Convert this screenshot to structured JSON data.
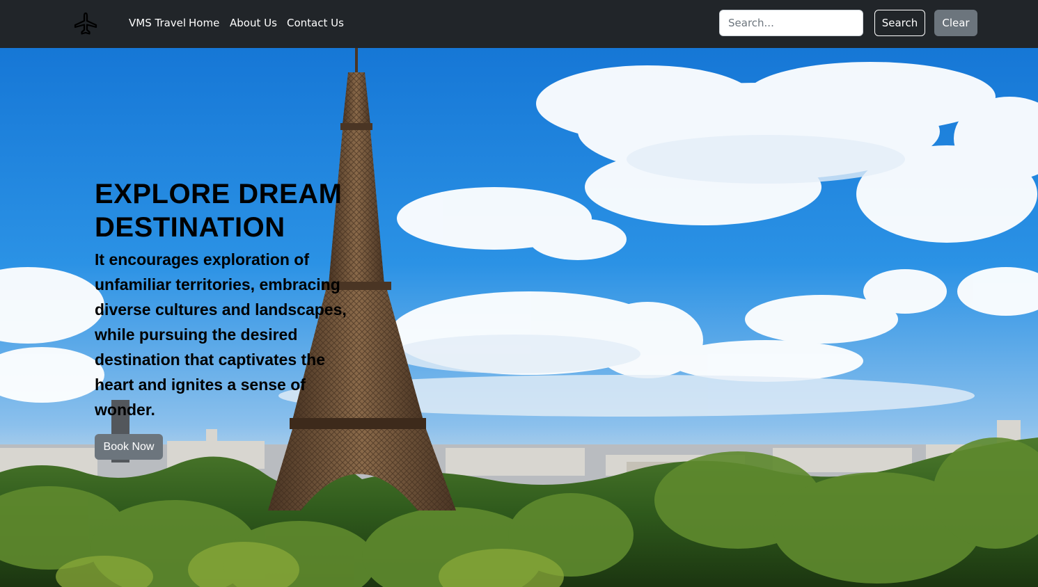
{
  "navbar": {
    "brand_icon": "airplane-icon",
    "brand_text": "VMS Travel",
    "links": {
      "home": "Home",
      "about": "About Us",
      "contact": "Contact Us"
    },
    "search": {
      "placeholder": "Search...",
      "value": ""
    },
    "search_button": "Search",
    "clear_button": "Clear"
  },
  "hero": {
    "title": "EXPLORE DREAM DESTINATION",
    "description": "It encourages exploration of unfamiliar territories, embracing diverse cultures and landscapes, while pursuing the desired destination that captivates the heart and ignites a sense of wonder.",
    "cta_button": "Book Now",
    "background_image": "eiffel-tower-paris-skyline"
  },
  "colors": {
    "navbar_bg": "#212529",
    "nav_text": "#ffffff",
    "secondary_button": "#6c757d",
    "sky": "#1f8ee6"
  }
}
